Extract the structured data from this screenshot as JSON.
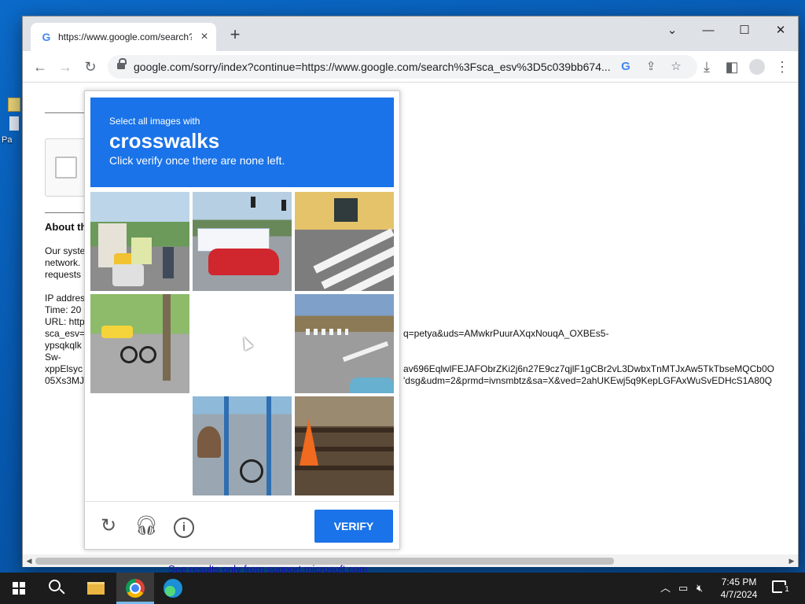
{
  "desktop": {
    "icon_label": "Pa"
  },
  "browser": {
    "tab_title": "https://www.google.com/search?",
    "tab_favicon": "G",
    "address_url": "google.com/sorry/index?continue=https://www.google.com/search%3Fsca_esv%3D5c039bb674...",
    "window_controls": {
      "minimize": "—",
      "maximize": "☐",
      "close": "✕",
      "tab_search": "⌄"
    }
  },
  "page": {
    "about_heading": "About th",
    "para_lines": [
      "Our syste",
      "network.",
      "requests"
    ],
    "ip_lines": [
      "IP addres",
      "Time: 20",
      "URL: http",
      "sca_esv=",
      "ypsqkqlk",
      "Sw-",
      "xppElsyc",
      "05Xs3MJ"
    ],
    "url_overflow_1": "q=petya&uds=AMwkrPuurAXqxNouqA_OXBEs5-",
    "url_overflow_2": "av696EqlwlFEJAFObrZKi2j6n27E9cz7qjlF1gCBr2vL3DwbxTnMTJxAw5TkTbseMQCb0O",
    "url_overflow_3": "'dsg&udm=2&prmd=ivnsmbtz&sa=X&ved=2ahUKEwj5q9KepLGFAxWuSvEDHcS1A80Q"
  },
  "behind_link": "See results only from support.microsoft.com",
  "captcha": {
    "instruction_pre": "Select all images with",
    "target": "crosswalks",
    "instruction_post": "Click verify once there are none left.",
    "verify_label": "VERIFY",
    "icons": {
      "reload": "reload-icon",
      "audio": "headphones-icon",
      "info": "info-icon"
    }
  },
  "taskbar": {
    "time": "7:45 PM",
    "date": "4/7/2024",
    "notification_count": "1"
  }
}
